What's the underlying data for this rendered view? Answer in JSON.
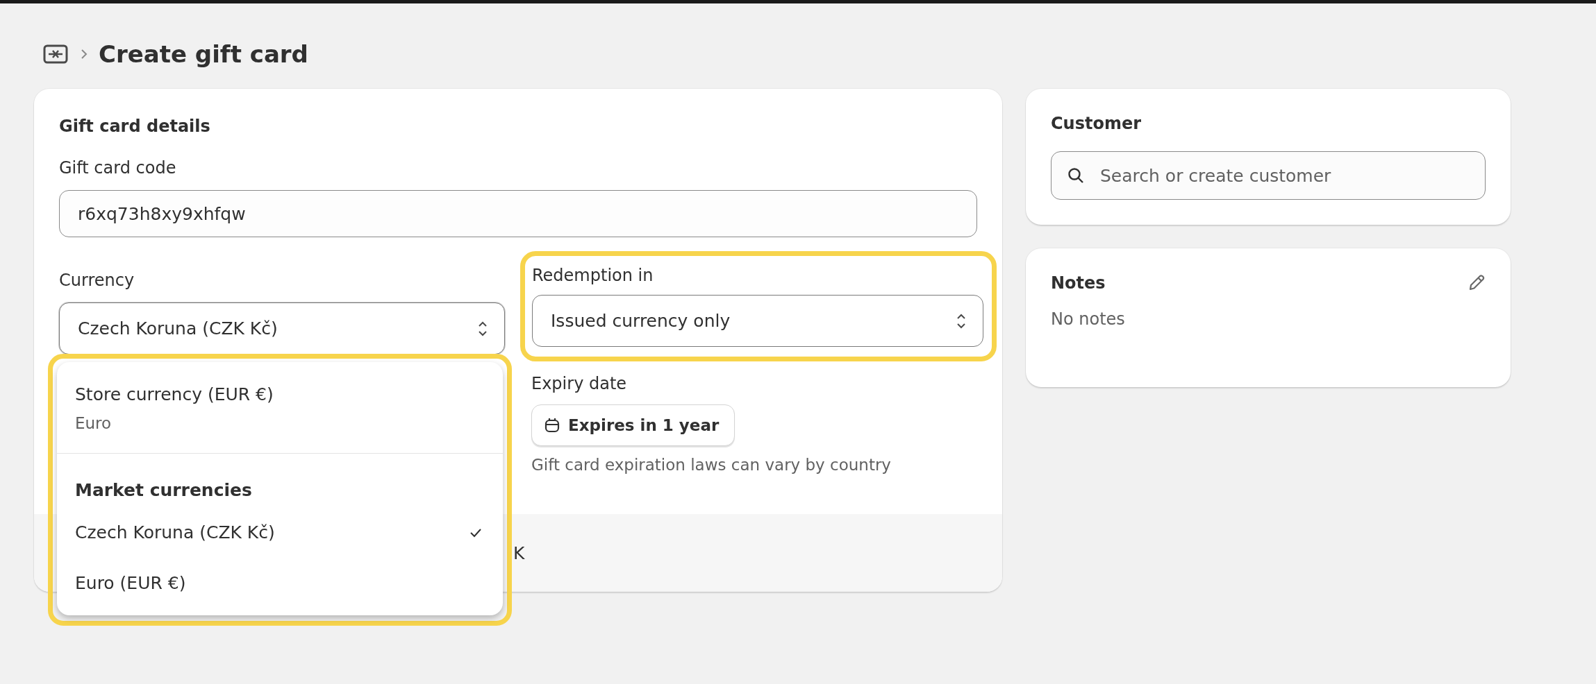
{
  "page": {
    "title": "Create gift card"
  },
  "details": {
    "heading": "Gift card details",
    "code": {
      "label": "Gift card code",
      "value": "r6xq73h8xy9xhfqw"
    },
    "currency": {
      "label": "Currency",
      "value": "Czech Koruna (CZK Kč)",
      "expanded": true,
      "menu": [
        {
          "kind": "option",
          "label": "Store currency (EUR €)",
          "sublabel": "Euro",
          "selected": false
        },
        {
          "kind": "heading",
          "label": "Market currencies"
        },
        {
          "kind": "option",
          "label": "Czech Koruna (CZK Kč)",
          "selected": true
        },
        {
          "kind": "option",
          "label": "Euro (EUR €)",
          "selected": false
        }
      ]
    },
    "redemption": {
      "label": "Redemption in",
      "value": "Issued currency only"
    },
    "expiry": {
      "label": "Expiry date",
      "button": "Expires in 1 year",
      "help": "Gift card expiration laws can vary by country"
    },
    "footer_text": "K"
  },
  "customer": {
    "heading": "Customer",
    "placeholder": "Search or create customer"
  },
  "notes": {
    "heading": "Notes",
    "text": "No notes"
  }
}
